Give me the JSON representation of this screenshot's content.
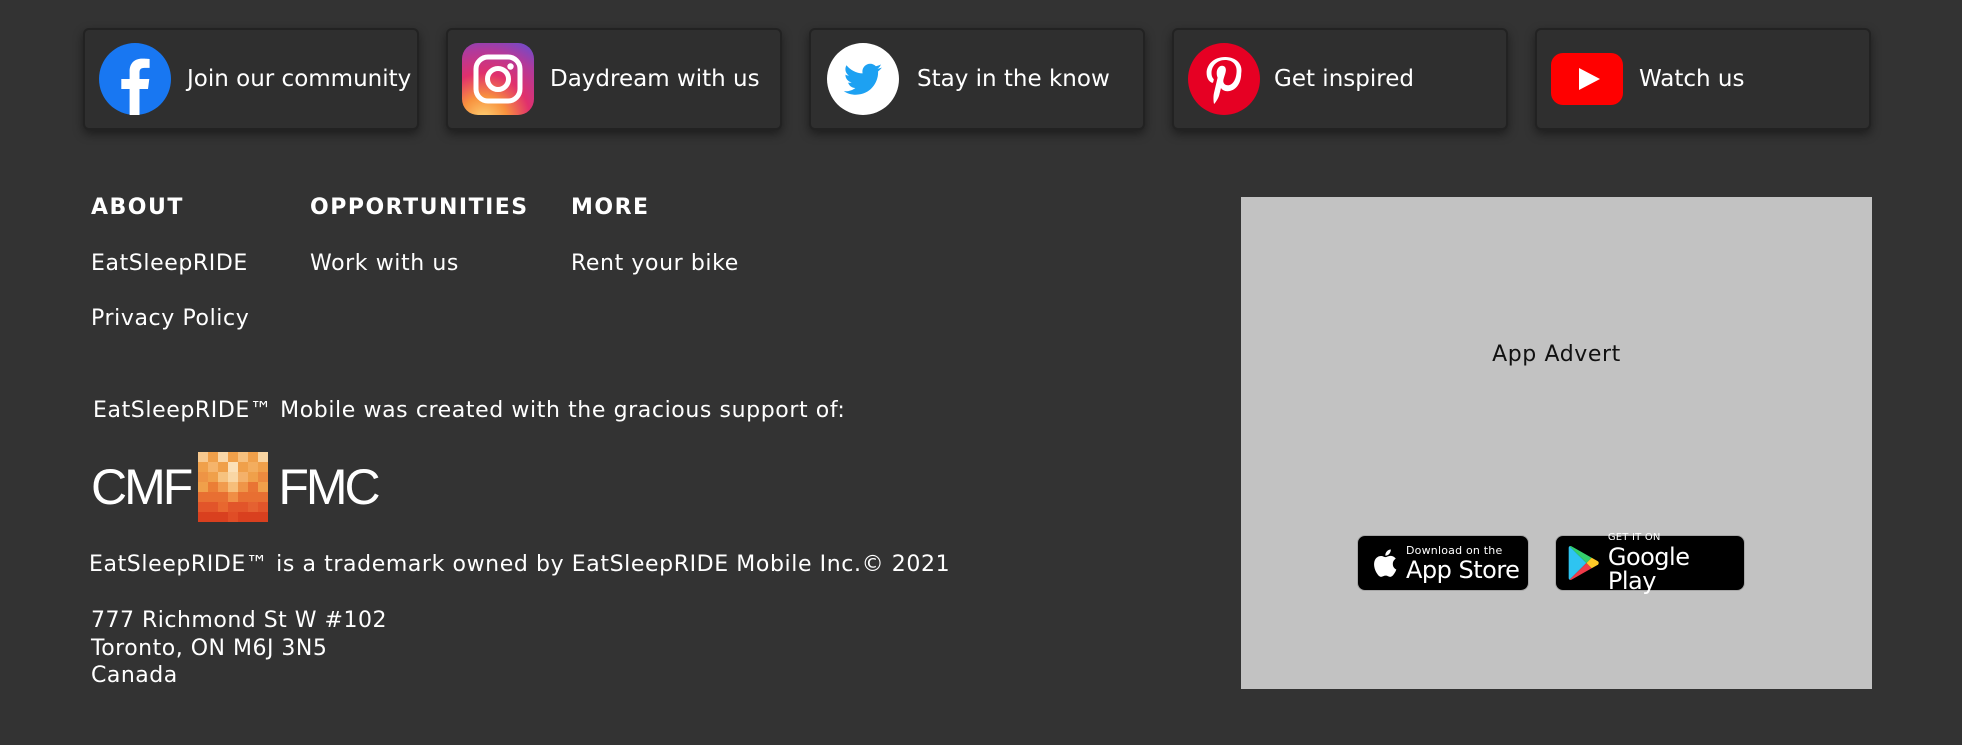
{
  "social": [
    {
      "label": "Join our community",
      "icon": "facebook-icon",
      "color": "#1877F2"
    },
    {
      "label": "Daydream with us",
      "icon": "instagram-icon",
      "color": "#E1306C"
    },
    {
      "label": "Stay in the know",
      "icon": "twitter-icon",
      "color": "#1DA1F2"
    },
    {
      "label": "Get inspired",
      "icon": "pinterest-icon",
      "color": "#E60023"
    },
    {
      "label": "Watch us",
      "icon": "youtube-icon",
      "color": "#FF0000"
    }
  ],
  "footer": {
    "columns": [
      {
        "heading": "ABOUT",
        "links": [
          "EatSleepRIDE",
          "Privacy Policy"
        ]
      },
      {
        "heading": "OPPORTUNITIES",
        "links": [
          "Work with us"
        ]
      },
      {
        "heading": "MORE",
        "links": [
          "Rent your bike"
        ]
      }
    ],
    "support_text": "EatSleepRIDE™ Mobile was created with the gracious support of:",
    "sponsor": {
      "left": "CMF",
      "right": "FMC"
    },
    "trademark": "EatSleepRIDE™ is a trademark owned by EatSleepRIDE Mobile Inc.© 2021",
    "address": [
      "777 Richmond St W #102",
      "Toronto, ON M6J 3N5",
      "Canada"
    ]
  },
  "app_advert": {
    "title": "App Advert",
    "app_store": {
      "small": "Download on the",
      "big": "App Store"
    },
    "google_play": {
      "small": "GET IT ON",
      "big": "Google Play"
    }
  },
  "colors": {
    "background": "#333333",
    "card": "#2f2f2f",
    "advert": "#c2c2c2"
  }
}
